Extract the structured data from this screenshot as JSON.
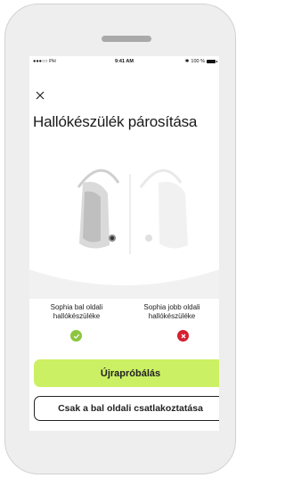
{
  "status_bar": {
    "carrier": "●●●○○ PH",
    "time": "9:41 AM",
    "battery": "100 %"
  },
  "title": "Hallókészülék párosítása",
  "devices": {
    "left_label": "Sophia bal oldali hallókészüléke",
    "right_label": "Sophia jobb oldali hallókészüléke",
    "left_status": "connected",
    "right_status": "failed"
  },
  "buttons": {
    "retry": "Újrapróbálás",
    "left_only": "Csak a bal oldali csatlakoztatása"
  },
  "colors": {
    "accent": "#ccf063",
    "success": "#8cc63f",
    "error": "#d42030"
  },
  "icons": {
    "close": "close-icon",
    "success": "check-icon",
    "error": "x-icon"
  }
}
